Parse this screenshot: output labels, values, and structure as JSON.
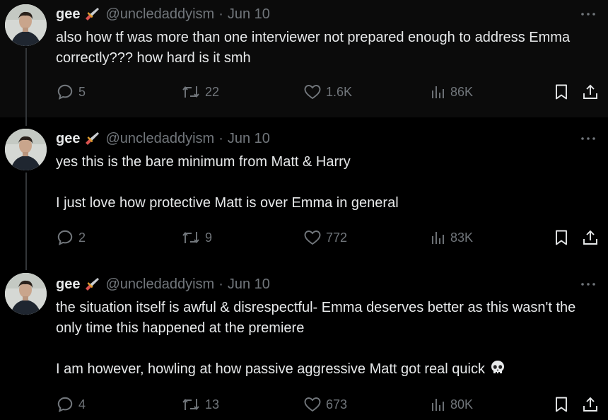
{
  "tweets": [
    {
      "name": "gee",
      "handle": "@uncledaddyism",
      "separator": "·",
      "date": "Jun 10",
      "text": [
        "also how tf was more than one interviewer not prepared enough to address Emma correctly??? how hard is it smh"
      ],
      "replies": "5",
      "retweets": "22",
      "likes": "1.6K",
      "views": "86K"
    },
    {
      "name": "gee",
      "handle": "@uncledaddyism",
      "separator": "·",
      "date": "Jun 10",
      "text": [
        "yes this is the bare minimum from Matt & Harry",
        "I just love how protective Matt is over Emma in general"
      ],
      "replies": "2",
      "retweets": "9",
      "likes": "772",
      "views": "83K"
    },
    {
      "name": "gee",
      "handle": "@uncledaddyism",
      "separator": "·",
      "date": "Jun 10",
      "text": [
        "the situation itself is awful & disrespectful- Emma deserves better as this wasn't the only time this happened at the premiere",
        "I am however, howling at how passive aggressive Matt got real quick"
      ],
      "replies": "4",
      "retweets": "13",
      "likes": "673",
      "views": "80K"
    }
  ],
  "icons": {
    "name_emoji": "dagger-icon",
    "end_emoji": "skull-icon",
    "more": "more-icon",
    "reply": "reply-icon",
    "retweet": "retweet-icon",
    "like": "heart-icon",
    "views": "views-icon",
    "bookmark": "bookmark-icon",
    "share": "share-icon"
  },
  "colors": {
    "background": "#000000",
    "text": "#e7e9ea",
    "secondary": "#71767b",
    "thread_line": "#333639"
  }
}
